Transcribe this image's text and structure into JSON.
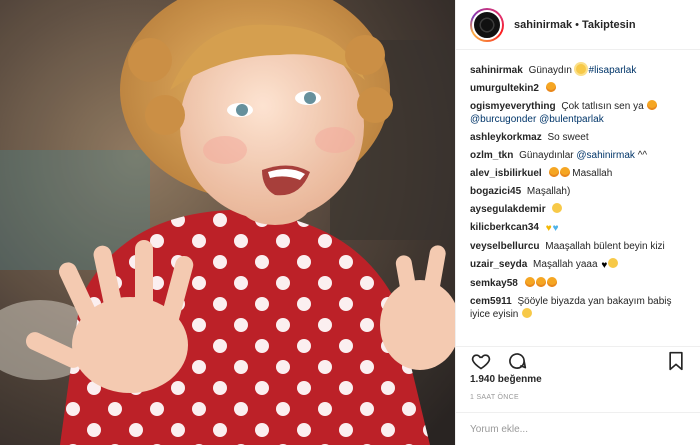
{
  "photo": {
    "alt": ""
  },
  "header": {
    "username": "sahinirmak",
    "separator": "•",
    "follow_status": "Takiptesin"
  },
  "comments": [
    {
      "user": "sahinirmak",
      "text": "Günaydın",
      "emoji": "sun",
      "tail_mention": "#lisaparlak"
    },
    {
      "user": "umurgultekin2",
      "text": "",
      "emoji": "love"
    },
    {
      "user": "ogismyeverything",
      "text": "Çok tatlısın sen ya",
      "emoji": "love",
      "line2": "@burcugonder @bulentparlak"
    },
    {
      "user": "ashleykorkmaz",
      "text": "So sweet"
    },
    {
      "user": "ozlm_tkn",
      "text": "Günaydınlar",
      "mention": "@sahinirmak",
      "suffix": "^^"
    },
    {
      "user": "alev_isbilirkuel",
      "text": "Masallah",
      "emoji_before": "love love"
    },
    {
      "user": "bogazici45",
      "text": "Maşallah)"
    },
    {
      "user": "aysegulakdemir",
      "text": "",
      "emoji": "smile"
    },
    {
      "user": "kilicberkcan34",
      "text": "",
      "emoji": "heart-y heart-b"
    },
    {
      "user": "veyselbellurcu",
      "text": "Maaşallah bülent beyin kizi"
    },
    {
      "user": "uzair_seyda",
      "text": "Maşallah yaaa",
      "emoji": "heart-k smile"
    },
    {
      "user": "semkay58",
      "text": "",
      "emoji": "love love love"
    },
    {
      "user": "cem5911",
      "text": "Şööyle biyazda yan bakayım babiş",
      "line2": "iyice eyisin",
      "line2_emoji": "smile"
    }
  ],
  "actions": {
    "like_icon": "heart-outline-icon",
    "comment_icon": "comment-bubble-icon",
    "save_icon": "bookmark-icon"
  },
  "likes": "1.940 beğenme",
  "timestamp": "1 SAAT ÖNCE",
  "add_comment": {
    "placeholder": "Yorum ekle..."
  },
  "colors": {
    "mention": "#003569",
    "border": "#efefef",
    "muted": "#999999"
  }
}
